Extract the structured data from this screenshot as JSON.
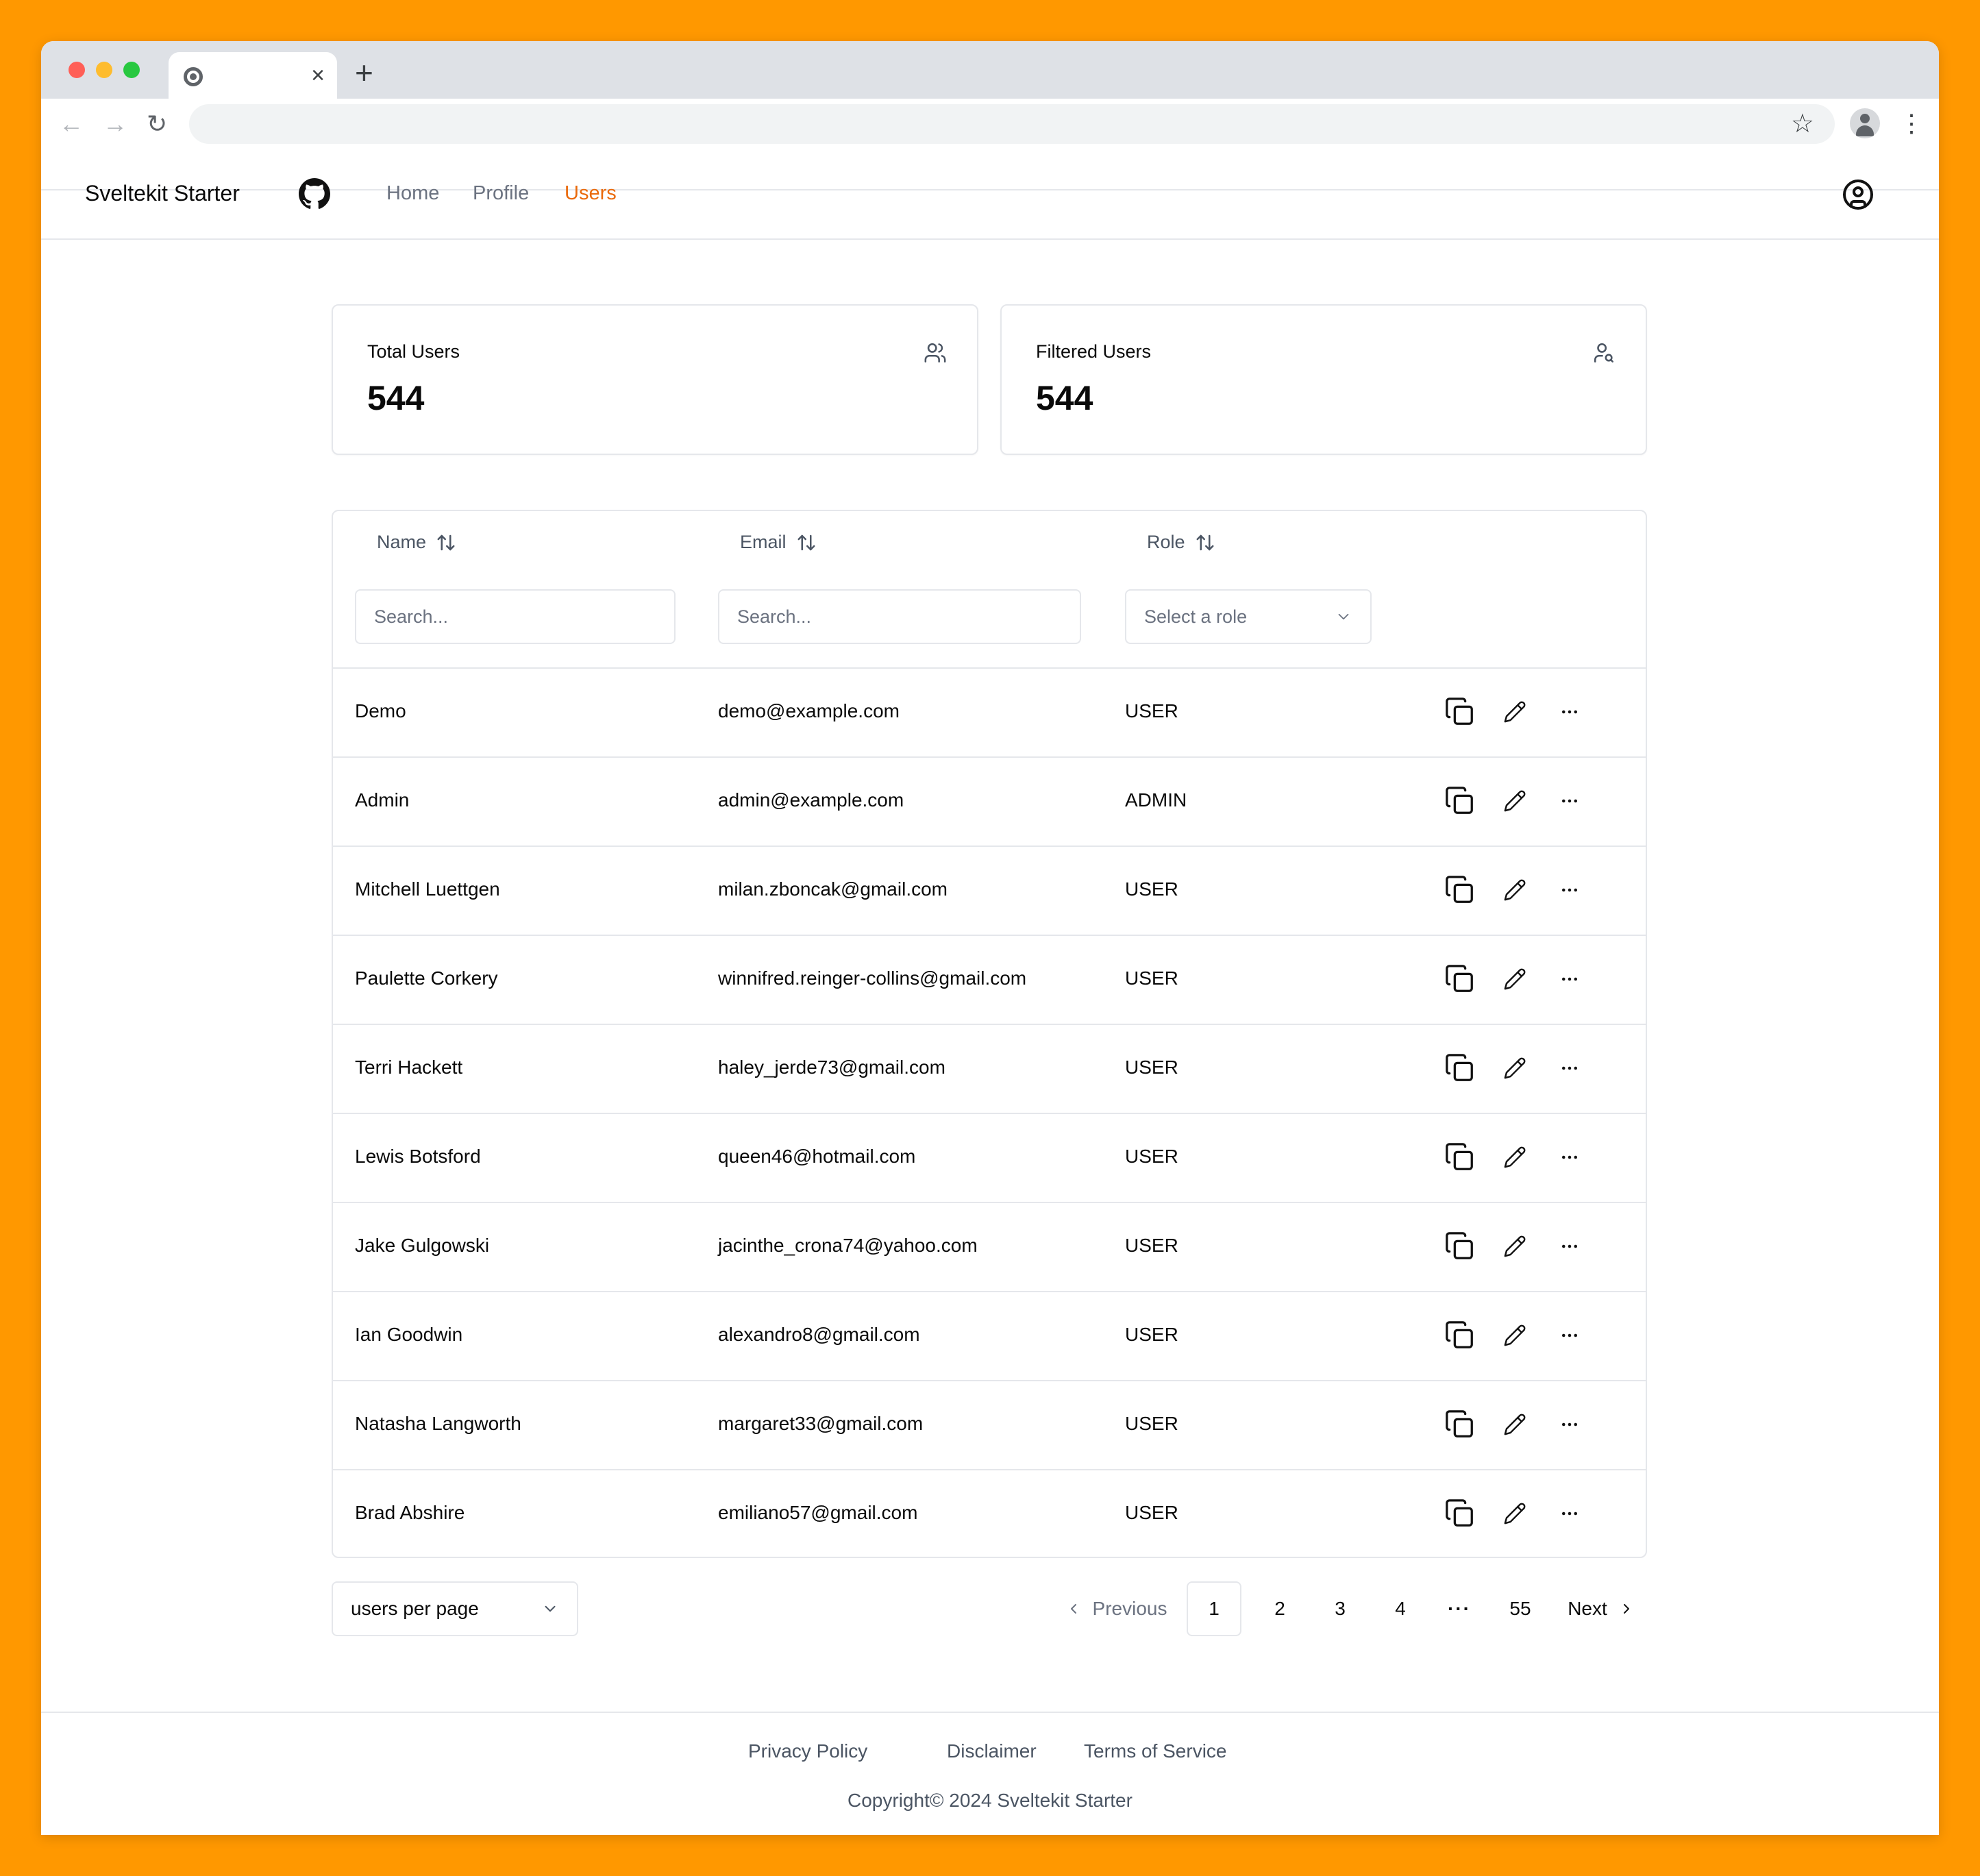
{
  "browser": {
    "tab_close": "×",
    "new_tab": "+",
    "back": "←",
    "forward": "→",
    "reload": "↻",
    "bookmark": "☆",
    "menu": "⋮"
  },
  "header": {
    "brand": "Sveltekit Starter",
    "nav": [
      {
        "label": "Home",
        "active": false
      },
      {
        "label": "Profile",
        "active": false
      },
      {
        "label": "Users",
        "active": true
      }
    ],
    "accent_color": "#ea6a0c"
  },
  "stats": [
    {
      "title": "Total Users",
      "value": "544",
      "icon": "users-icon"
    },
    {
      "title": "Filtered Users",
      "value": "544",
      "icon": "user-search-icon"
    }
  ],
  "table": {
    "columns": [
      {
        "label": "Name",
        "icon": "sort-icon"
      },
      {
        "label": "Email",
        "icon": "sort-icon"
      },
      {
        "label": "Role",
        "icon": "sort-icon"
      }
    ],
    "filters": {
      "name_placeholder": "Search...",
      "email_placeholder": "Search...",
      "role_placeholder": "Select a role"
    },
    "rows": [
      {
        "name": "Demo",
        "email": "demo@example.com",
        "role": "USER"
      },
      {
        "name": "Admin",
        "email": "admin@example.com",
        "role": "ADMIN"
      },
      {
        "name": "Mitchell Luettgen",
        "email": "milan.zboncak@gmail.com",
        "role": "USER"
      },
      {
        "name": "Paulette Corkery",
        "email": "winnifred.reinger-collins@gmail.com",
        "role": "USER"
      },
      {
        "name": "Terri Hackett",
        "email": "haley_jerde73@gmail.com",
        "role": "USER"
      },
      {
        "name": "Lewis Botsford",
        "email": "queen46@hotmail.com",
        "role": "USER"
      },
      {
        "name": "Jake Gulgowski",
        "email": "jacinthe_crona74@yahoo.com",
        "role": "USER"
      },
      {
        "name": "Ian Goodwin",
        "email": "alexandro8@gmail.com",
        "role": "USER"
      },
      {
        "name": "Natasha Langworth",
        "email": "margaret33@gmail.com",
        "role": "USER"
      },
      {
        "name": "Brad Abshire",
        "email": "emiliano57@gmail.com",
        "role": "USER"
      }
    ],
    "row_actions": [
      "copy-icon",
      "pencil-icon",
      "more-horizontal-icon"
    ]
  },
  "pagination": {
    "per_page_label": "users per page",
    "previous": "Previous",
    "pages": [
      "1",
      "2",
      "3",
      "4"
    ],
    "ellipsis": "···",
    "last_page": "55",
    "next": "Next",
    "current": "1"
  },
  "footer": {
    "links": [
      "Privacy Policy",
      "Disclaimer",
      "Terms of Service"
    ],
    "copyright": "Copyright© 2024 Sveltekit Starter"
  }
}
